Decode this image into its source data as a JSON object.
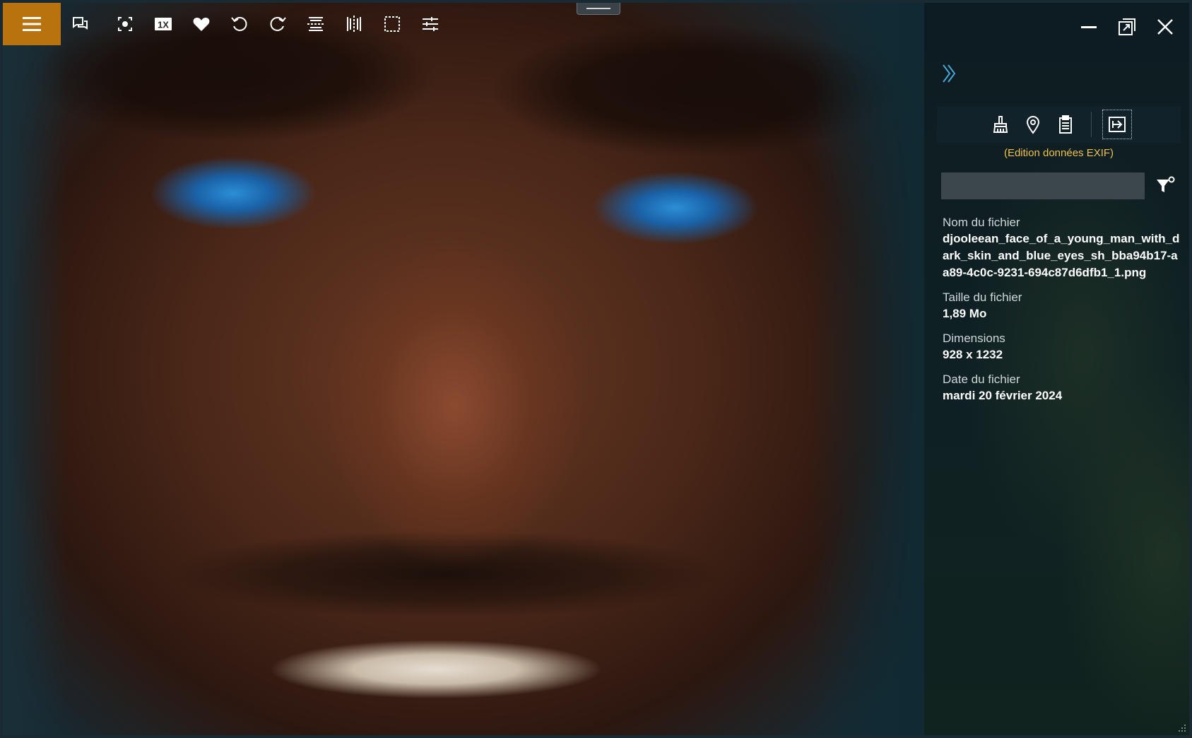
{
  "toolbar": {
    "menu_icon": "hamburger-icon",
    "buttons": [
      {
        "icon": "chat-icon"
      },
      {
        "icon": "focus-icon"
      },
      {
        "icon": "actual-size-icon",
        "label": "1X"
      },
      {
        "icon": "heart-icon"
      },
      {
        "icon": "rotate-left-icon"
      },
      {
        "icon": "rotate-right-icon"
      },
      {
        "icon": "flip-vertical-icon"
      },
      {
        "icon": "flip-horizontal-icon"
      },
      {
        "icon": "crop-icon"
      },
      {
        "icon": "adjustments-icon"
      }
    ]
  },
  "window_controls": [
    "minimize-icon",
    "restore-icon",
    "close-icon"
  ],
  "panel": {
    "collapse_icon": "chevron-double-right-icon",
    "tools": [
      "broom-icon",
      "location-pin-icon",
      "clipboard-icon",
      "export-icon"
    ],
    "exif_label": "(Edition données EXIF)",
    "filter_placeholder": "",
    "filter_icon": "filter-settings-icon",
    "info": [
      {
        "label": "Nom du fichier",
        "value": "djooleean_face_of_a_young_man_with_dark_skin_and_blue_eyes_sh_bba94b17-aa89-4c0c-9231-694c87d6dfb1_1.png"
      },
      {
        "label": "Taille du fichier",
        "value": "1,89 Mo"
      },
      {
        "label": "Dimensions",
        "value": "928 x 1232"
      },
      {
        "label": "Date du fichier",
        "value": "mardi 20 février 2024"
      }
    ]
  },
  "colors": {
    "accent": "#b8730f",
    "exif_label": "#f0c24a",
    "panel_bg": "#0f1f24"
  }
}
